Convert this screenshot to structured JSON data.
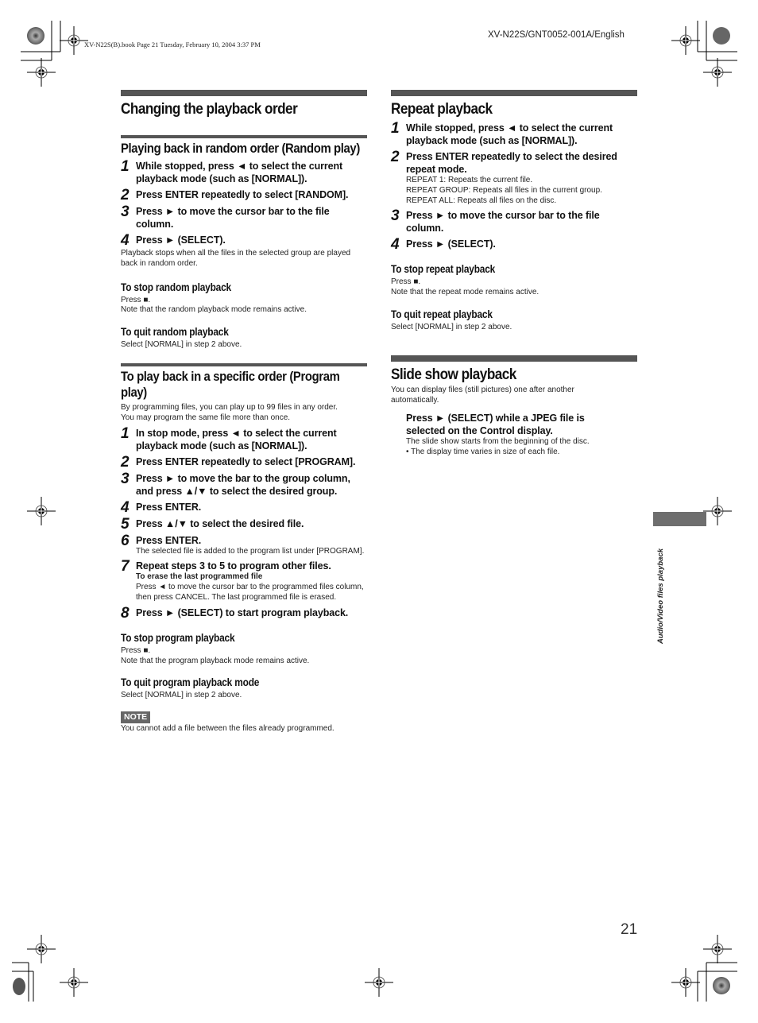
{
  "header": {
    "book_info": "XV-N22S(B).book  Page 21  Tuesday, February 10, 2004  3:37 PM",
    "doc_code": "XV-N22S/GNT0052-001A/English"
  },
  "left": {
    "section_title": "Changing the playback order",
    "random": {
      "title": "Playing back in random order (Random play)",
      "steps": [
        {
          "num": "1",
          "text": "While stopped, press ◄ to select the current playback mode (such as [NORMAL])."
        },
        {
          "num": "2",
          "text": "Press ENTER repeatedly to select [RANDOM]."
        },
        {
          "num": "3",
          "text": "Press ► to move the cursor bar to the file column."
        },
        {
          "num": "4",
          "text": "Press ► (SELECT)."
        }
      ],
      "after_note": "Playback stops when all the files in the selected group are played back in random order.",
      "stop_title": "To stop random playback",
      "stop_line1": "Press ■.",
      "stop_line2": "Note that the random playback mode remains active.",
      "quit_title": "To quit random playback",
      "quit_text": "Select [NORMAL] in step 2 above."
    },
    "program": {
      "title": "To play back in a specific order (Program play)",
      "intro_line1": "By programming files, you can play up to 99 files in any order.",
      "intro_line2": "You may program the same file more than once.",
      "steps": [
        {
          "num": "1",
          "text": "In stop mode, press ◄ to select the current playback mode (such as [NORMAL])."
        },
        {
          "num": "2",
          "text": "Press ENTER repeatedly to select [PROGRAM]."
        },
        {
          "num": "3",
          "text": "Press ► to move the bar to the group column, and press ▲/▼ to select the desired group."
        },
        {
          "num": "4",
          "text": "Press ENTER."
        },
        {
          "num": "5",
          "text": "Press ▲/▼ to select the desired file."
        },
        {
          "num": "6",
          "text": "Press ENTER.",
          "note": "The selected file is added to the program list under [PROGRAM]."
        },
        {
          "num": "7",
          "text": "Repeat steps 3 to 5 to program other files.",
          "note_title": "To erase the last programmed file",
          "note": "Press ◄ to move the cursor bar to the programmed files column, then press CANCEL. The last programmed file is erased."
        },
        {
          "num": "8",
          "text": "Press ► (SELECT) to start program playback."
        }
      ],
      "stop_title": "To stop program playback",
      "stop_line1": "Press ■.",
      "stop_line2": "Note that the program playback mode remains active.",
      "quit_title": "To quit program playback mode",
      "quit_text": "Select [NORMAL] in step 2 above.",
      "note_label": "NOTE",
      "note_text": "You cannot add a file between the files already programmed."
    }
  },
  "right": {
    "repeat": {
      "title": "Repeat playback",
      "steps": [
        {
          "num": "1",
          "text": "While stopped, press ◄ to select the current playback mode (such as [NORMAL])."
        },
        {
          "num": "2",
          "text": "Press ENTER repeatedly to select the desired repeat mode.",
          "notes": [
            "REPEAT 1: Repeats the current file.",
            "REPEAT GROUP: Repeats all files in the current group.",
            "REPEAT ALL: Repeats all files on the disc."
          ]
        },
        {
          "num": "3",
          "text": "Press ► to move the cursor bar to the file column."
        },
        {
          "num": "4",
          "text": "Press ► (SELECT)."
        }
      ],
      "stop_title": "To stop repeat playback",
      "stop_line1": "Press ■.",
      "stop_line2": "Note that the repeat mode remains active.",
      "quit_title": "To quit repeat playback",
      "quit_text": "Select [NORMAL] in step 2 above."
    },
    "slideshow": {
      "title": "Slide show playback",
      "intro": "You can display files (still pictures) one after another automatically.",
      "instruction": "Press ► (SELECT) while a JPEG file is selected on the Control display.",
      "note_line1": "The slide show starts from the beginning of the disc.",
      "note_line2": "• The display time varies in size of each file."
    }
  },
  "side_tab": {
    "label": "Audio/Video files playback"
  },
  "footer": {
    "page_number": "21"
  },
  "icons": {
    "registration_mark": "crosshair-circle-icon",
    "color_wheel": "printer-color-target-icon"
  }
}
